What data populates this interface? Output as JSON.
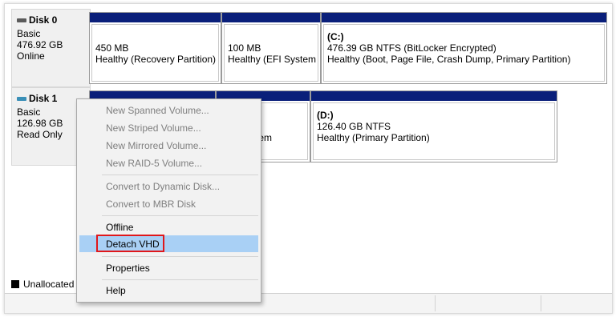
{
  "disks": [
    {
      "name": "Disk 0",
      "type": "Basic",
      "size": "476.92 GB",
      "status": "Online",
      "icon_color": "#5a5a5a",
      "partitions": [
        {
          "title": "",
          "line1": "450 MB",
          "line2": "Healthy (Recovery Partition)"
        },
        {
          "title": "",
          "line1": "100 MB",
          "line2": "Healthy (EFI System P"
        },
        {
          "title": "(C:)",
          "line1": "476.39 GB NTFS (BitLocker Encrypted)",
          "line2": "Healthy (Boot, Page File, Crash Dump, Primary Partition)"
        }
      ]
    },
    {
      "name": "Disk 1",
      "type": "Basic",
      "size": "126.98 GB",
      "status": "Read Only",
      "icon_color": "#3a8fb7",
      "partitions": [
        {
          "title": "",
          "line1": "",
          "line2": ""
        },
        {
          "title": "",
          "line1": "",
          "line2": "EFI System"
        },
        {
          "title": "(D:)",
          "line1": "126.40 GB NTFS",
          "line2": "Healthy (Primary Partition)"
        }
      ]
    }
  ],
  "legend": {
    "unallocated": "Unallocated"
  },
  "context_menu": {
    "items": [
      {
        "label": "New Spanned Volume...",
        "enabled": false
      },
      {
        "label": "New Striped Volume...",
        "enabled": false
      },
      {
        "label": "New Mirrored Volume...",
        "enabled": false
      },
      {
        "label": "New RAID-5 Volume...",
        "enabled": false
      },
      {
        "label": "Convert to Dynamic Disk...",
        "enabled": false
      },
      {
        "label": "Convert to MBR Disk",
        "enabled": false
      },
      {
        "label": "Offline",
        "enabled": true
      },
      {
        "label": "Detach VHD",
        "enabled": true,
        "highlighted": true
      },
      {
        "label": "Properties",
        "enabled": true
      },
      {
        "label": "Help",
        "enabled": true
      }
    ]
  },
  "colors": {
    "partition_bar": "#0a1f7a",
    "highlight": "#a9d0f5",
    "annotation_box": "#e0171b"
  }
}
